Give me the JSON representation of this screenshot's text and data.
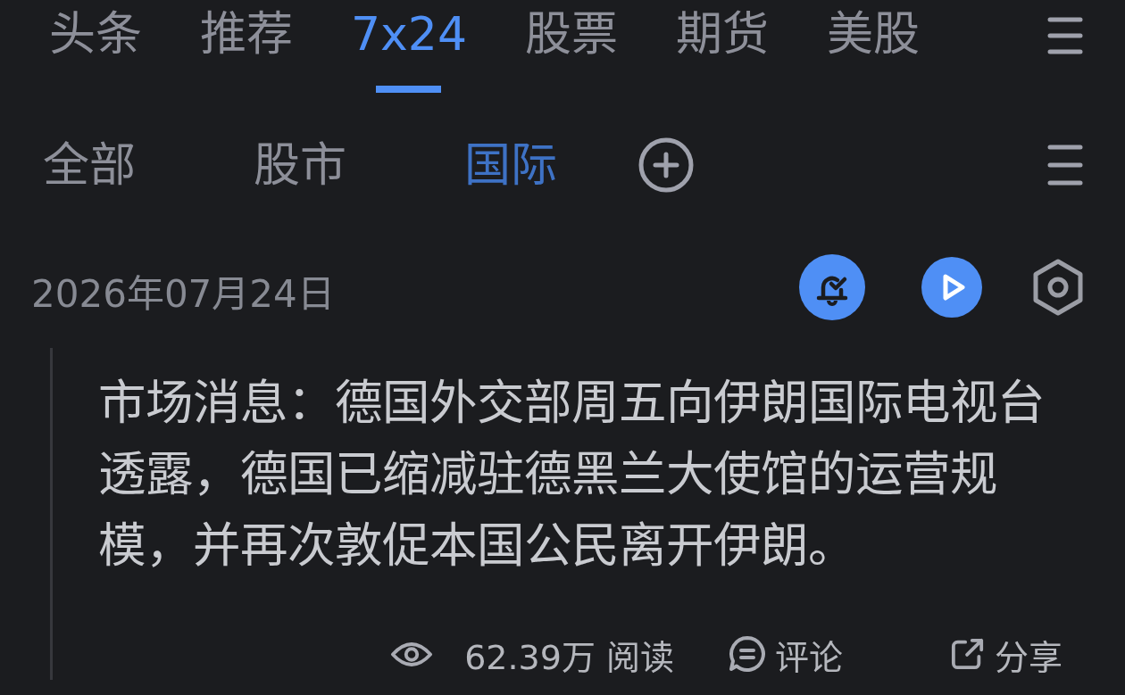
{
  "top_tabs": [
    {
      "label": "头条",
      "selected": false
    },
    {
      "label": "推荐",
      "selected": false
    },
    {
      "label": "7x24",
      "selected": true
    },
    {
      "label": "股票",
      "selected": false
    },
    {
      "label": "期货",
      "selected": false
    },
    {
      "label": "美股",
      "selected": false
    }
  ],
  "sub_tabs": [
    {
      "label": "全部",
      "selected": false
    },
    {
      "label": "股市",
      "selected": false
    },
    {
      "label": "国际",
      "selected": true
    }
  ],
  "date": "2026年07月24日",
  "news": {
    "text": "市场消息：德国外交部周五向伊朗国际电视台透露，德国已缩减驻德黑兰大使馆的运营规模，并再次敦促本国公民离开伊朗。",
    "views": "62.39万 阅读",
    "comment": "评论",
    "share": "分享"
  }
}
